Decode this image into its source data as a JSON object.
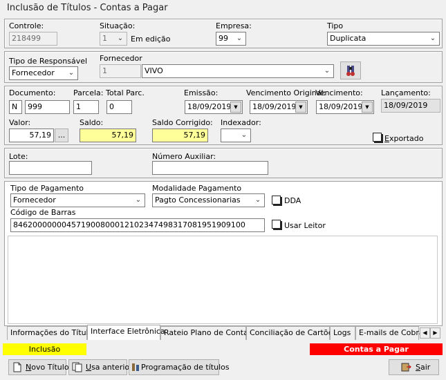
{
  "window": {
    "title": "Inclusão de Títulos - Contas a Pagar"
  },
  "header": {
    "controle_label": "Controle:",
    "controle_value": "218499",
    "situacao_label": "Situação:",
    "situacao_value": "1",
    "situacao_text": "Em edição",
    "empresa_label": "Empresa:",
    "empresa_value": "99",
    "tipo_label": "Tipo",
    "tipo_value": "Duplicata"
  },
  "responsavel": {
    "tipo_label": "Tipo de Responsável",
    "tipo_value": "Fornecedor",
    "fornecedor_label": "Fornecedor",
    "fornecedor_code": "1",
    "fornecedor_name": "VIVO"
  },
  "documento": {
    "documento_label": "Documento:",
    "documento_prefix": "N",
    "documento_value": "999",
    "parcela_label": "Parcela:",
    "parcela_value": "1",
    "total_parc_label": "Total Parc.",
    "total_parc_value": "0",
    "emissao_label": "Emissão:",
    "emissao_value": "18/09/2019",
    "venc_original_label": "Vencimento Original:",
    "venc_original_value": "18/09/2019",
    "vencimento_label": "Vencimento:",
    "vencimento_value": "18/09/2019",
    "lancamento_label": "Lançamento:",
    "lancamento_value": "18/09/2019",
    "valor_label": "Valor:",
    "valor_value": "57,19",
    "valor_btn": "...",
    "saldo_label": "Saldo:",
    "saldo_value": "57,19",
    "saldo_corrigido_label": "Saldo Corrigido:",
    "saldo_corrigido_value": "57,19",
    "indexador_label": "Indexador:",
    "indexador_value": "",
    "exportado_label": "Exportado"
  },
  "lote": {
    "lote_label": "Lote:",
    "lote_value": "",
    "numero_aux_label": "Número Auxiliar:",
    "numero_aux_value": ""
  },
  "pagamento": {
    "tipo_label": "Tipo de Pagamento",
    "tipo_value": "Fornecedor",
    "modalidade_label": "Modalidade Pagamento",
    "modalidade_value": "Pagto Concessionarias",
    "dda_label": "DDA",
    "codigo_barras_label": "Código de Barras",
    "codigo_barras_value": "84620000000457190080001210234749831708195190910​0",
    "usar_leitor_label": "Usar Leitor"
  },
  "tabs": [
    {
      "label": "Informações do Título"
    },
    {
      "label": "Interface Eletrônica"
    },
    {
      "label": "Rateio Plano de Contas"
    },
    {
      "label": "Conciliação de Cartões"
    },
    {
      "label": "Logs"
    },
    {
      "label": "E-mails de Cobra"
    }
  ],
  "status": {
    "left": "Inclusão",
    "right": "Contas a Pagar"
  },
  "buttons": {
    "novo_titulo_pre": "",
    "novo_titulo_u": "N",
    "novo_titulo_rest": "ovo Título",
    "usa_anterior_pre": "",
    "usa_anterior_u": "U",
    "usa_anterior_rest": "sa anterior",
    "programacao": "Programação de títulos",
    "sair_pre": "",
    "sair_u": "S",
    "sair_rest": "air"
  },
  "colors": {
    "yellow_field": "#ffff99",
    "status_yellow": "#ffff00",
    "status_red": "#ff0000"
  }
}
